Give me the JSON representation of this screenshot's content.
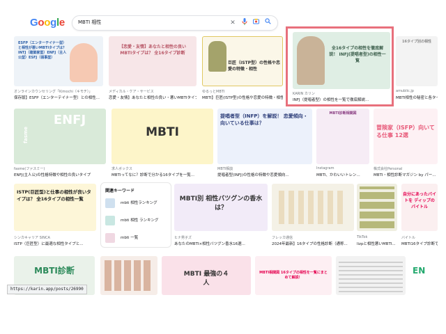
{
  "header": {
    "logo": [
      "G",
      "o",
      "o",
      "g",
      "l",
      "e"
    ],
    "logo_colors": [
      "#4285f4",
      "#ea4335",
      "#fbbc05",
      "#4285f4",
      "#34a853",
      "#ea4335"
    ],
    "search_value": "MBTI 相性",
    "icons": [
      "close-icon",
      "mic-icon",
      "camera-icon",
      "search-icon"
    ]
  },
  "row1": [
    {
      "text": "ESFP（エンターテイナー型）と相性が悪いMBTIタイプは？ INTJ（建築家型）ENFJ（主人公型）ESFJ（領事型）",
      "src": "オンラインカウンセリング「Kimochi（キモチ）」",
      "title": "保存版】ESFP（エンターテイナー型）との相性...",
      "bg": "#eef3f8",
      "fg": "#2b5ea7"
    },
    {
      "text": "【恋愛・友情】あなたと相性の良いMBTIタイプは？ 全16タイプ診断",
      "src": "メディカル・ケア・サービス",
      "title": "恋愛・友情】あなたと相性の良い・悪いMBTIタイプ...",
      "bg": "#f7e6e8",
      "fg": "#b85666"
    },
    {
      "text": "巨匠（ISTP型）の性格や恋愛の特徴・相性",
      "src": "ゆるっとMBTI",
      "title": "MBTI】巨匠(ISTP型)の性格や恋愛の特徴・相性...",
      "bg": "#fbf7e8",
      "fg": "#333333"
    },
    {
      "text": "全16タイプの相性を徹底解説！ INFJ(提唱者型)の相性一覧",
      "src": "KARIN カリン",
      "title": "INFJ（提唱者型）の相性を一覧で徹底解説...",
      "bg": "#dfeee4",
      "fg": "#3a5d4a"
    },
    {
      "text": "16タイプ別の相性",
      "src": "amublic.jp",
      "title": "MBTI相性の秘密と各タイプの...",
      "bg": "#f3f3f3",
      "fg": "#888888"
    }
  ],
  "row2": [
    {
      "text": "ENFJ",
      "sub": "fasme",
      "src": "fasme(ファスミー)",
      "title": "ENFJ(主人公)の性格特徴や相性の良いタイプ",
      "bg": "#d9ead9",
      "fg": "#ffffff"
    },
    {
      "text": "MBTI",
      "src": "求人ボックス",
      "title": "MBTIってなに？診断で分かる16タイプを一覧...",
      "bg": "#fdf5c9",
      "fg": "#333333"
    },
    {
      "text": "提唱者型（INFP）を解説！ 恋愛傾向・向いている仕事は？",
      "src": "MBTI相談",
      "title": "提唱者型(INFJ)の性格の特徴や恋愛傾向...",
      "bg": "#ecf1fb",
      "fg": "#2e3f7a"
    },
    {
      "text": "MBTI診断相関図",
      "src": "Instagram",
      "title": "MBTI、かわいいトレン...",
      "bg": "#f6ecf5",
      "fg": "#8a3f83"
    },
    {
      "text": "冒険家（ISFP）向いてる仕事 12選",
      "src": "株式会社Personal",
      "title": "MBTI・相性診断マガジン by パー...",
      "bg": "#fdf1f4",
      "fg": "#e85b7a"
    }
  ],
  "row3": [
    {
      "text": "ISTP(巨匠型)と仕事の相性が良いタイプは？ 全16タイプの相性一覧",
      "src": "シンカキャリア SINCA",
      "title": "ISTP（巨匠型）に最適な相性タイプと...",
      "bg": "#fdf6d8",
      "fg": "#222222"
    },
    {
      "text": "MBTI別 相性バツグンの香水は？",
      "src": "ヒナ男子ズ",
      "title": "あなたのMBTI×相性バツグン香水16選...",
      "bg": "#f2ebf8",
      "fg": "#333333"
    },
    {
      "text": "",
      "src": "フレッカ通信",
      "title": "2024年最新】16タイプの性格診断（通称...",
      "bg": "#f4f1e6",
      "fg": "#333333"
    },
    {
      "text": "",
      "src": "TikTok",
      "title": "lizpと相性悪いMBTI...",
      "bg": "#efeee0",
      "fg": "#333333"
    },
    {
      "text": "自分にあったバイトを ディップのバイトル",
      "src": "バイトル",
      "title": "MBTI16タイプ診断でわかる...",
      "bg": "#fbeff0",
      "fg": "#e5004f"
    }
  ],
  "keywords": {
    "heading": "関連キーワード",
    "items": [
      "mbti 相性ランキング",
      "mbti 相性 ランキング",
      "mbti 一覧"
    ]
  },
  "row4": [
    {
      "text": "MBTI診断",
      "bg": "#eaf2ea",
      "fg": "#2c8a5a"
    },
    {
      "text": "",
      "bg": "#f6ede8",
      "fg": "#333333"
    },
    {
      "text": "MBTI 最強の４人",
      "bg": "#fae1e9",
      "fg": "#333333"
    },
    {
      "text": "MBTI相関図 16タイプの相性を一覧にまとめて解説！",
      "bg": "#fdeff3",
      "fg": "#e5004f"
    },
    {
      "text": "",
      "bg": "#f2f2f2",
      "fg": "#333333"
    },
    {
      "text": "EN",
      "bg": "#ffffff",
      "fg": "#23a96e"
    }
  ],
  "status_url": "https://karin.app/posts/26990"
}
